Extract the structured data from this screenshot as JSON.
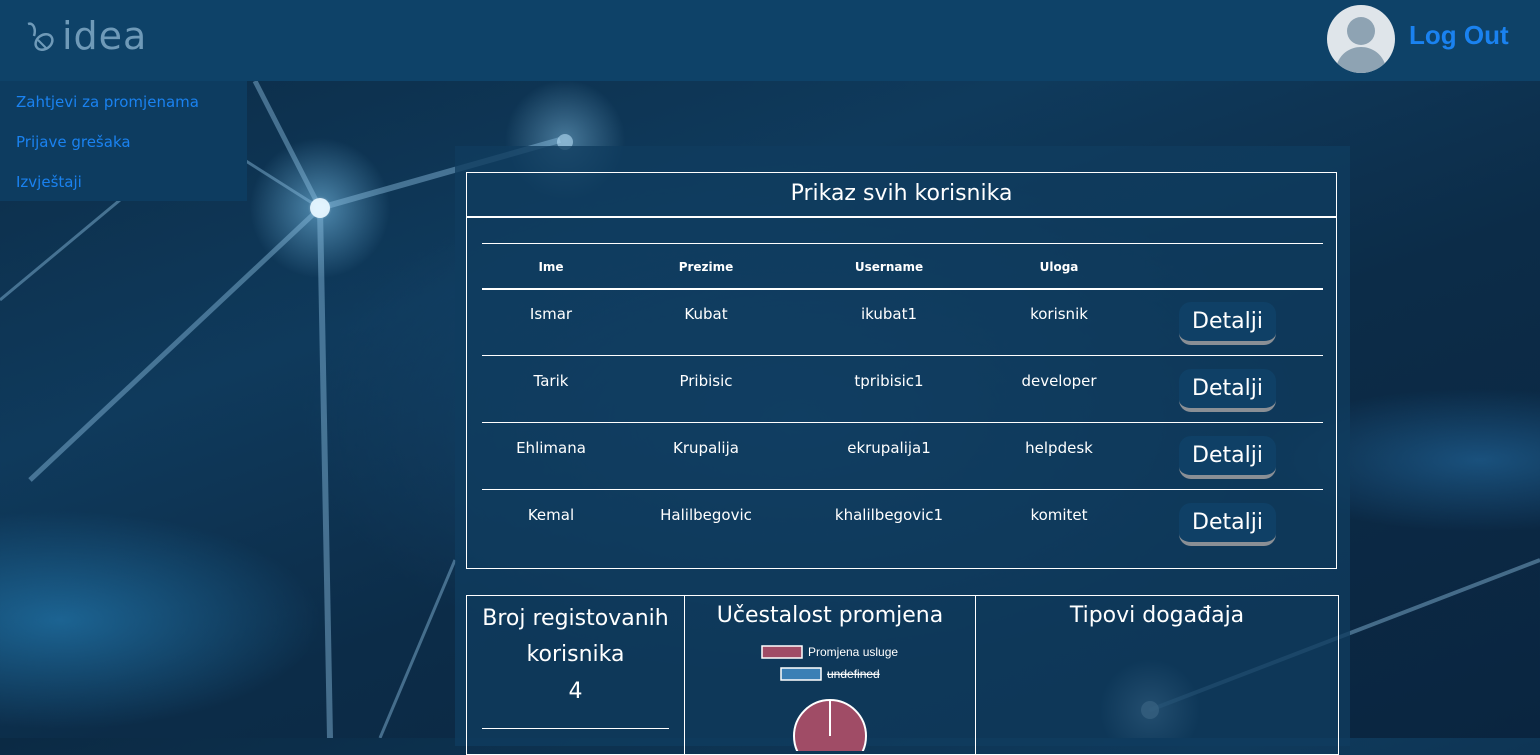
{
  "header": {
    "logo_text": "idea",
    "logout_label": "Log Out"
  },
  "sidebar": {
    "items": [
      {
        "label": "Zahtjevi za promjenama"
      },
      {
        "label": "Prijave grešaka"
      },
      {
        "label": "Izvještaji"
      }
    ]
  },
  "users_table": {
    "title": "Prikaz svih korisnika",
    "columns": [
      "Ime",
      "Prezime",
      "Username",
      "Uloga"
    ],
    "rows": [
      {
        "ime": "Ismar",
        "prezime": "Kubat",
        "username": "ikubat1",
        "uloga": "korisnik",
        "action": "Detalji"
      },
      {
        "ime": "Tarik",
        "prezime": "Pribisic",
        "username": "tpribisic1",
        "uloga": "developer",
        "action": "Detalji"
      },
      {
        "ime": "Ehlimana",
        "prezime": "Krupalija",
        "username": "ekrupalija1",
        "uloga": "helpdesk",
        "action": "Detalji"
      },
      {
        "ime": "Kemal",
        "prezime": "Halilbegovic",
        "username": "khalilbegovic1",
        "uloga": "komitet",
        "action": "Detalji"
      }
    ]
  },
  "stats": {
    "registered": {
      "title_line1": "Broj registovanih",
      "title_line2": "korisnika",
      "value": "4"
    },
    "frequency": {
      "title": "Učestalost promjena"
    },
    "events": {
      "title": "Tipovi događaja"
    }
  },
  "chart_data": {
    "type": "pie",
    "legend": [
      "Promjena usluge",
      "undefined"
    ],
    "colors": [
      "#a04c66",
      "#3a7fb5"
    ],
    "values": [
      1
    ]
  }
}
